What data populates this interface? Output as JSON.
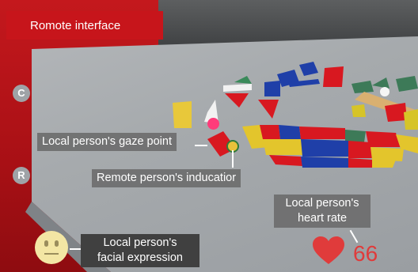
{
  "header": {
    "title": "Romote interface"
  },
  "side_buttons": {
    "c": "C",
    "r": "R"
  },
  "labels": {
    "gaze_point": "Local person's gaze point",
    "indicator": "Remote person's inducatior",
    "heart_rate_line1": "Local person's",
    "heart_rate_line2": "heart rate",
    "facial_line1": "Local person's",
    "facial_line2": "facial expression"
  },
  "heart_rate": {
    "value": "66"
  },
  "colors": {
    "accent_red": "#c7151b",
    "gaze_marker": "#ff3b7a",
    "indicator_marker": "#e8c23a",
    "heart": "#e03b3b"
  },
  "icons": {
    "heart": "heart-icon",
    "face": "neutral-face-icon"
  }
}
